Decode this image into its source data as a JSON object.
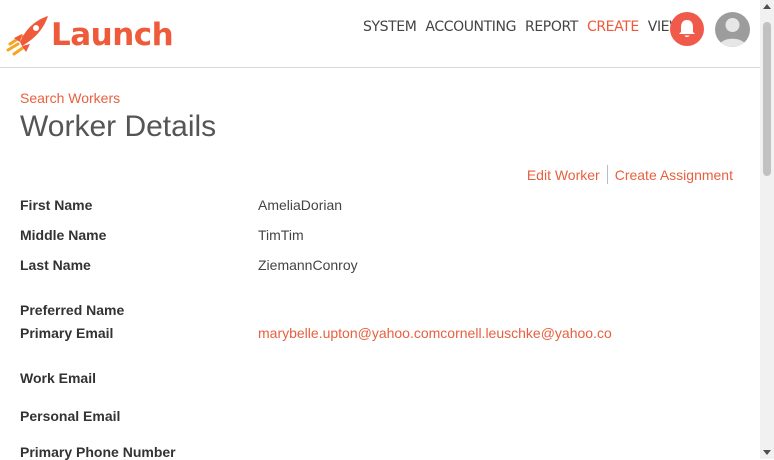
{
  "header": {
    "brand": "Launch",
    "nav": [
      "SYSTEM",
      "ACCOUNTING",
      "REPORT",
      "CREATE",
      "VIEW"
    ],
    "active_nav": "CREATE",
    "accent": "#ee5a3a",
    "icons": {
      "logo": "rocket-icon",
      "notifications": "bell-icon",
      "user": "avatar-icon"
    }
  },
  "breadcrumb": "Search Workers",
  "title": "Worker Details",
  "actions": {
    "edit": "Edit Worker",
    "create_assignment": "Create Assignment"
  },
  "fields": {
    "first_name": {
      "label": "First Name",
      "value": "AmeliaDorian"
    },
    "middle_name": {
      "label": "Middle Name",
      "value": "TimTim"
    },
    "last_name": {
      "label": "Last Name",
      "value": "ZiemannConroy"
    },
    "preferred_name": {
      "label": "Preferred Name",
      "value": ""
    },
    "primary_email": {
      "label": "Primary Email",
      "value": "marybelle.upton@yahoo.comcornell.leuschke@yahoo.co"
    },
    "work_email": {
      "label": "Work Email",
      "value": ""
    },
    "personal_email": {
      "label": "Personal Email",
      "value": ""
    },
    "primary_phone": {
      "label": "Primary Phone Number",
      "value": ""
    }
  }
}
